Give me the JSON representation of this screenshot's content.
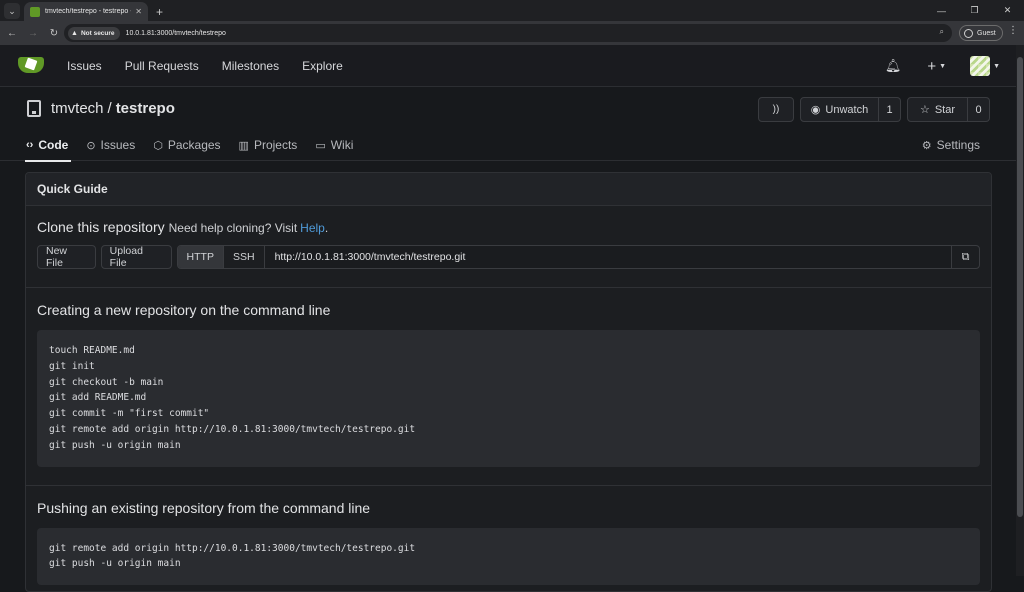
{
  "browser": {
    "tab_title": "tmvtech/testrepo - testrepo - Gitea",
    "new_tab": "+",
    "security": "Not secure",
    "url": "10.0.1.81:3000/tmvtech/testrepo",
    "profile": "Guest"
  },
  "header": {
    "nav": [
      "Issues",
      "Pull Requests",
      "Milestones",
      "Explore"
    ]
  },
  "repo": {
    "owner": "tmvtech",
    "separator": "/",
    "name": "testrepo",
    "unwatch_label": "Unwatch",
    "watch_count": "1",
    "star_label": "Star",
    "star_count": "0",
    "tabs": {
      "code": "Code",
      "issues": "Issues",
      "packages": "Packages",
      "projects": "Projects",
      "wiki": "Wiki",
      "settings": "Settings"
    }
  },
  "guide": {
    "title": "Quick Guide",
    "clone_title": "Clone this repository",
    "help_pre": "Need help cloning? Visit",
    "help_link": "Help",
    "new_file": "New File",
    "upload_file": "Upload File",
    "http": "HTTP",
    "ssh": "SSH",
    "clone_url": "http://10.0.1.81:3000/tmvtech/testrepo.git",
    "new_repo_title": "Creating a new repository on the command line",
    "new_repo_cmds": [
      "touch README.md",
      "git init",
      "git checkout -b main",
      "git add README.md",
      "git commit -m \"first commit\"",
      "git remote add origin http://10.0.1.81:3000/tmvtech/testrepo.git",
      "git push -u origin main"
    ],
    "push_title": "Pushing an existing repository from the command line",
    "push_cmds": [
      "git remote add origin http://10.0.1.81:3000/tmvtech/testrepo.git",
      "git push -u origin main"
    ]
  }
}
